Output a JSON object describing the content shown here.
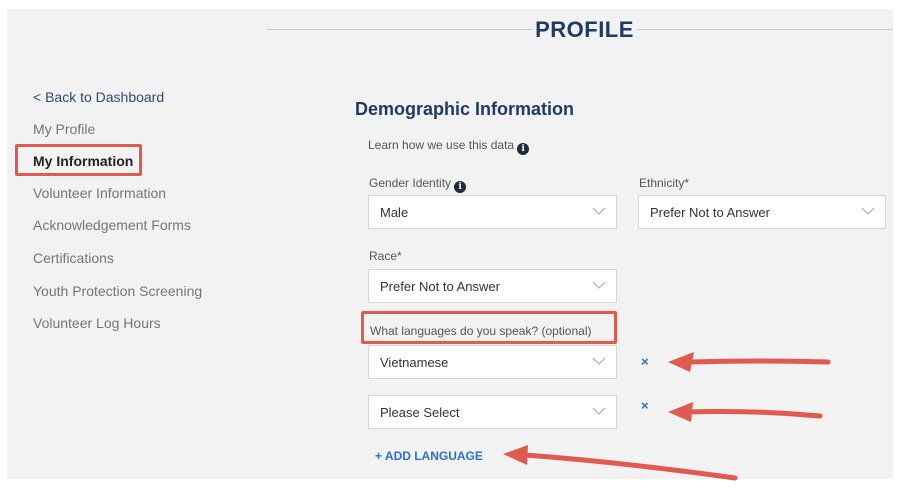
{
  "header": {
    "title": "PROFILE"
  },
  "sidebar": {
    "items": [
      {
        "label": "< Back to Dashboard"
      },
      {
        "label": "My Profile"
      },
      {
        "label": "My Information"
      },
      {
        "label": "Volunteer Information"
      },
      {
        "label": "Acknowledgement Forms"
      },
      {
        "label": "Certifications"
      },
      {
        "label": "Youth Protection Screening"
      },
      {
        "label": "Volunteer Log Hours"
      }
    ]
  },
  "main": {
    "section_title": "Demographic Information",
    "learn_text": "Learn how we use this data",
    "gender": {
      "label": "Gender Identity",
      "value": "Male"
    },
    "ethnicity": {
      "label": "Ethnicity*",
      "value": "Prefer Not to Answer"
    },
    "race": {
      "label": "Race*",
      "value": "Prefer Not to Answer"
    },
    "languages": {
      "label": "What languages do you speak? (optional)",
      "selects": [
        {
          "value": "Vietnamese",
          "remove": "×"
        },
        {
          "value": "Please Select",
          "remove": "×"
        }
      ],
      "add_label": "+ ADD LANGUAGE"
    }
  },
  "colors": {
    "accent": "#1f3a66",
    "link": "#2a6fd1",
    "annotation": "#e05a4f",
    "canvas": "#f2f2f2"
  },
  "icons": [
    "info-icon",
    "chevron-down-icon",
    "close-icon",
    "arrow-annotation"
  ]
}
